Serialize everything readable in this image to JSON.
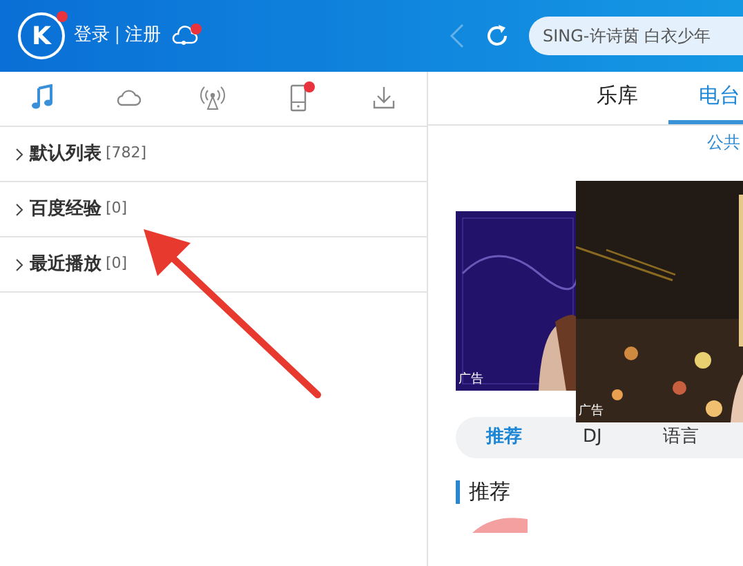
{
  "header": {
    "logo": "K",
    "login": "登录",
    "separator": "|",
    "register": "注册",
    "cloud_badge": true,
    "back_disabled": true,
    "search": {
      "placeholder": "SING-许诗茵 白衣少年"
    }
  },
  "side_tabs": [
    {
      "kind": "music",
      "selected": true,
      "badge": false
    },
    {
      "kind": "cloud",
      "selected": false,
      "badge": false
    },
    {
      "kind": "radio",
      "selected": false,
      "badge": false
    },
    {
      "kind": "device",
      "selected": false,
      "badge": true
    },
    {
      "kind": "download",
      "selected": false,
      "badge": false
    }
  ],
  "playlists": [
    {
      "name": "默认列表",
      "count": "[782]"
    },
    {
      "name": "百度经验",
      "count": "[0]"
    },
    {
      "name": "最近播放",
      "count": "[0]"
    }
  ],
  "main_tabs": [
    {
      "label": "乐库",
      "selected": false
    },
    {
      "label": "电台",
      "selected": true
    }
  ],
  "sub_link": "公共",
  "banners": [
    {
      "kind": "picture",
      "tag": "广告"
    },
    {
      "kind": "picture",
      "tag": "广告"
    }
  ],
  "category_tabs": [
    {
      "label": "推荐",
      "selected": true
    },
    {
      "label": "DJ",
      "selected": false
    },
    {
      "label": "语言",
      "selected": false
    }
  ],
  "section_title": "推荐",
  "annotation": {
    "kind": "arrow"
  }
}
